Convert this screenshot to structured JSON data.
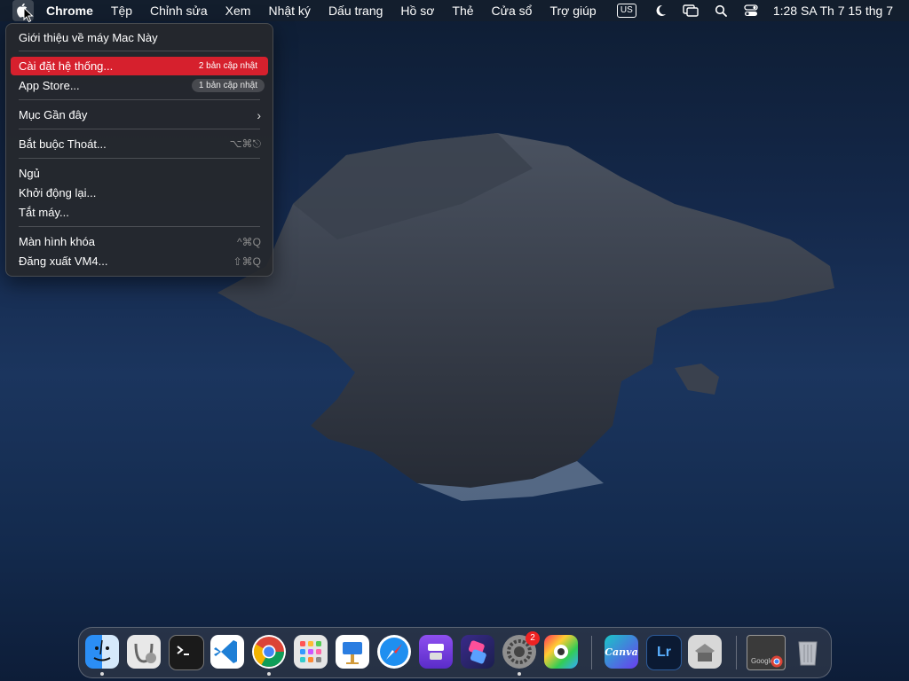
{
  "menubar": {
    "app_name": "Chrome",
    "items": [
      "Tệp",
      "Chỉnh sửa",
      "Xem",
      "Nhật ký",
      "Dấu trang",
      "Hồ sơ",
      "Thẻ",
      "Cửa sổ",
      "Trợ giúp"
    ],
    "input_source": "US",
    "clock": "1:28 SA Th 7 15 thg 7"
  },
  "apple_menu": {
    "about": "Giới thiệu về máy Mac Này",
    "system_settings": "Cài đặt hệ thống...",
    "system_settings_badge": "2 bản cập nhật",
    "app_store": "App Store...",
    "app_store_badge": "1 bản cập nhật",
    "recent_items": "Mục Gần đây",
    "force_quit": "Bắt buộc Thoát...",
    "force_quit_shortcut": "⌥⌘⎋",
    "sleep": "Ngủ",
    "restart": "Khởi động lại...",
    "shutdown": "Tắt máy...",
    "lock_screen": "Màn hình khóa",
    "lock_screen_shortcut": "^⌘Q",
    "logout": "Đăng xuất VM4...",
    "logout_shortcut": "⇧⌘Q"
  },
  "dock": {
    "settings_badge": "2",
    "canva_label": "Canva",
    "lightroom_label": "Lr",
    "google_label": "Google"
  },
  "colors": {
    "menu_highlight": "#d6202d",
    "menubar_bg": "#141e2d"
  }
}
